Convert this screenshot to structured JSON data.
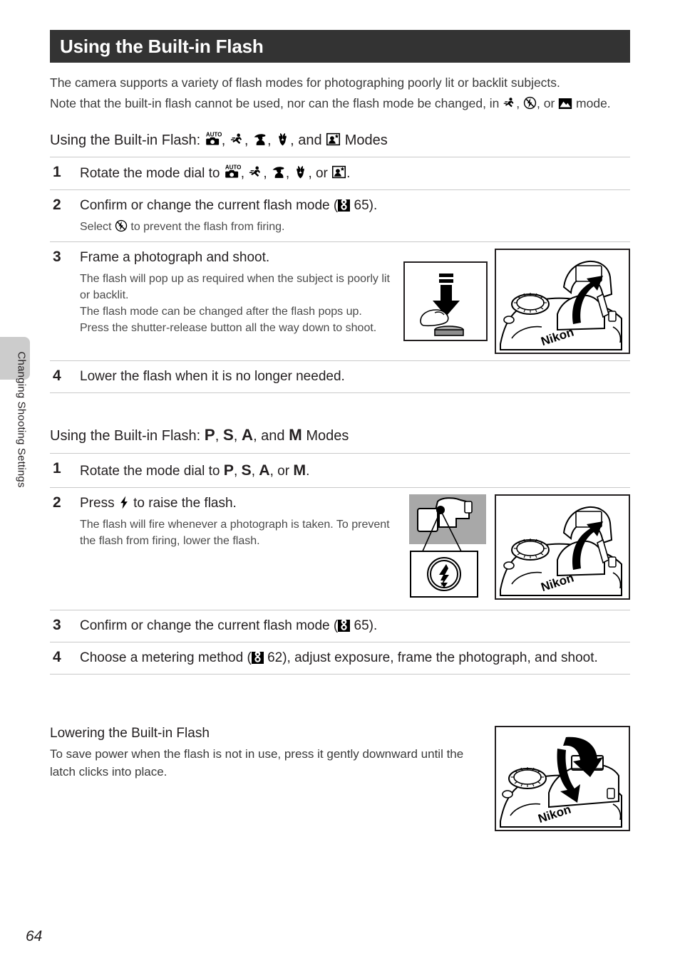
{
  "page": {
    "number": "64",
    "side_tab_label": "Changing Shooting Settings",
    "title": "Using the Built-in Flash"
  },
  "intro": {
    "p1": "The camera supports a variety of flash modes for photographing poorly lit or backlit subjects.",
    "p2_part1": "Note that the built-in flash cannot be used, nor can the flash mode be changed, in ",
    "p2_part2": ", ",
    "p2_part3": ", or ",
    "p2_part4": " mode."
  },
  "section1": {
    "heading_prefix": "Using the Built-in Flash: ",
    "heading_suffix": " Modes",
    "heading_and": ", and ",
    "modes": [
      "auto-mode-icon",
      "sports-mode-icon",
      "portrait-mode-icon",
      "close-up-mode-icon",
      "night-portrait-mode-icon"
    ],
    "steps": [
      {
        "num": "1",
        "title_prefix": "Rotate the mode dial to ",
        "title_or": ", or ",
        "title_suffix": "."
      },
      {
        "num": "2",
        "title_prefix": "Confirm or change the current flash mode (",
        "title_page": "65",
        "title_suffix": ").",
        "sub_prefix": "Select ",
        "sub_suffix": " to prevent the flash from firing."
      },
      {
        "num": "3",
        "title": "Frame a photograph and shoot.",
        "sub_lines": [
          "The flash will pop up as required when the subject is poorly lit or backlit.",
          "The flash mode can be changed after the flash pops up.",
          "Press the shutter-release button all the way down to shoot."
        ]
      },
      {
        "num": "4",
        "title": "Lower the flash when it is no longer needed."
      }
    ]
  },
  "section2": {
    "heading_prefix": "Using the Built-in Flash: ",
    "heading_suffix": " Modes",
    "heading_and": ", and ",
    "modes": [
      "P",
      "S",
      "A",
      "M"
    ],
    "steps": [
      {
        "num": "1",
        "title_prefix": "Rotate the mode dial to ",
        "title_or": ", or ",
        "title_suffix": "."
      },
      {
        "num": "2",
        "title_prefix": "Press ",
        "title_suffix": " to raise the flash.",
        "sub": "The flash will fire whenever a photograph is taken. To prevent the flash from firing, lower the flash."
      },
      {
        "num": "3",
        "title_prefix": "Confirm or change the current flash mode (",
        "title_page": "65",
        "title_suffix": ")."
      },
      {
        "num": "4",
        "title_prefix": "Choose a metering method (",
        "title_page": "62",
        "title_suffix": "), adjust exposure, frame the photograph, and shoot."
      }
    ]
  },
  "note": {
    "heading": "Lowering the Built-in Flash",
    "body": "To save power when the flash is not in use, press it gently downward until the latch clicks into place."
  },
  "figures": {
    "shutter_press": "shutter-press-illustration",
    "flash_popup": "camera-flash-popup-illustration",
    "flash_button": "flash-button-location-illustration",
    "flash_lower": "camera-flash-lower-illustration",
    "brand": "Nikon"
  },
  "colors": {
    "title_bar": "#333333",
    "rule": "#c9c9c9",
    "tab": "#cccccc",
    "ink": "#231f20"
  }
}
